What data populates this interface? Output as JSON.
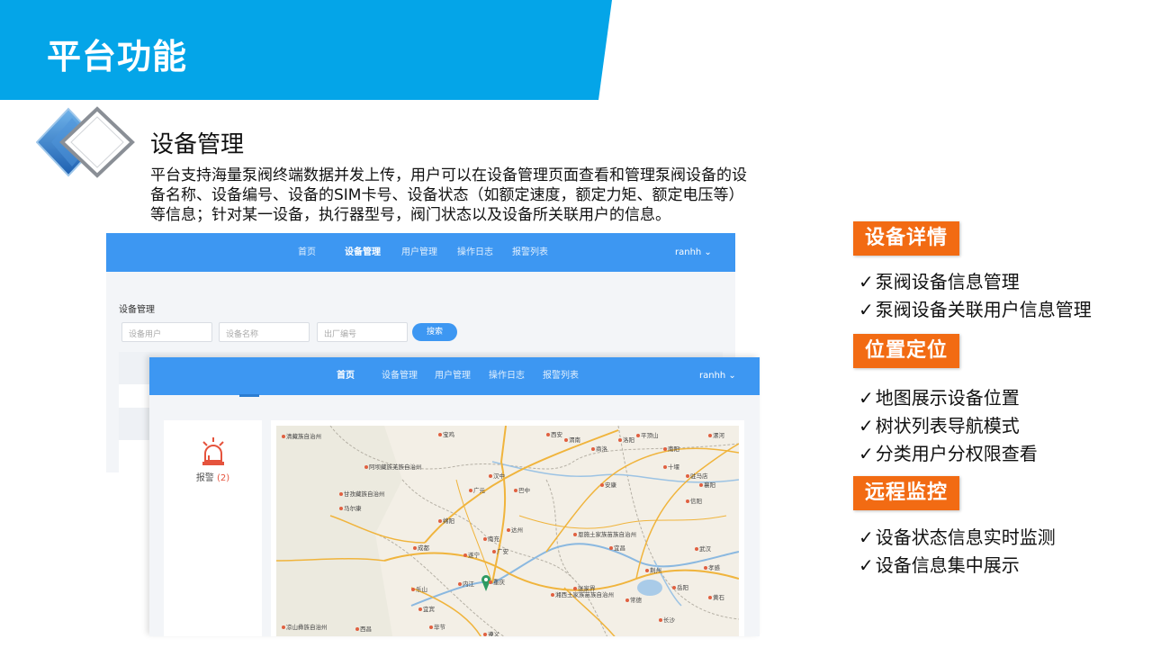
{
  "title": "平台功能",
  "colors": {
    "band": "#04a5e8",
    "nav": "#3d97f2",
    "tag": "#f26b13",
    "alarm": "#e5533d"
  },
  "section": {
    "title": "设备管理",
    "desc_lines": [
      "平台支持海量泵阀终端数据并发上传，用户可以在设备管理页面查看和管理泵阀设备的设",
      "备名称、设备编号、设备的SIM卡号、设备状态（如额定速度，额定力矩、额定电压等）",
      "等信息；针对某一设备，执行器型号，阀门状态以及设备所关联用户的信息。"
    ]
  },
  "screenshot1": {
    "nav": [
      "首页",
      "设备管理",
      "用户管理",
      "操作日志",
      "报警列表"
    ],
    "active_index": 1,
    "user": "ranhh ⌄",
    "label": "设备管理",
    "fields": [
      "设备用户",
      "设备名称",
      "出厂编号"
    ],
    "button": "搜索"
  },
  "screenshot2": {
    "nav": [
      "首页",
      "设备管理",
      "用户管理",
      "操作日志",
      "报警列表"
    ],
    "active_index": 0,
    "user": "ranhh ⌄",
    "alarm_label": "报警",
    "alarm_count": "(2)",
    "map_labels": [
      "清藏族自治州",
      "宝鸡",
      "西安",
      "汉中",
      "广元",
      "巴中",
      "达州",
      "绵阳",
      "南充",
      "成都",
      "遂宁",
      "广安",
      "重庆",
      "乐山",
      "内江",
      "宜宾",
      "阿坝藏族羌族自治州",
      "甘孜藏族自治州",
      "马尔康",
      "安康",
      "十堰",
      "襄阳",
      "宜昌",
      "荆州",
      "武汉",
      "恩施土家族苗族自治州",
      "湘西土家族苗族自治州",
      "张家界",
      "常德",
      "长沙",
      "岳阳",
      "南阳",
      "信阳",
      "驻马店",
      "孝感",
      "黄石",
      "凉山彝族自治州",
      "西昌",
      "毕节",
      "遵义",
      "商洛",
      "渭南",
      "洛阳",
      "平顶山",
      "漯河"
    ]
  },
  "features": [
    {
      "tag": "设备详情",
      "items": [
        "泵阀设备信息管理",
        "泵阀设备关联用户信息管理"
      ]
    },
    {
      "tag": "位置定位",
      "items": [
        "地图展示设备位置",
        "树状列表导航模式",
        "分类用户分权限查看"
      ]
    },
    {
      "tag": "远程监控",
      "items": [
        "设备状态信息实时监测",
        "设备信息集中展示"
      ]
    }
  ],
  "check_glyph": "✓"
}
